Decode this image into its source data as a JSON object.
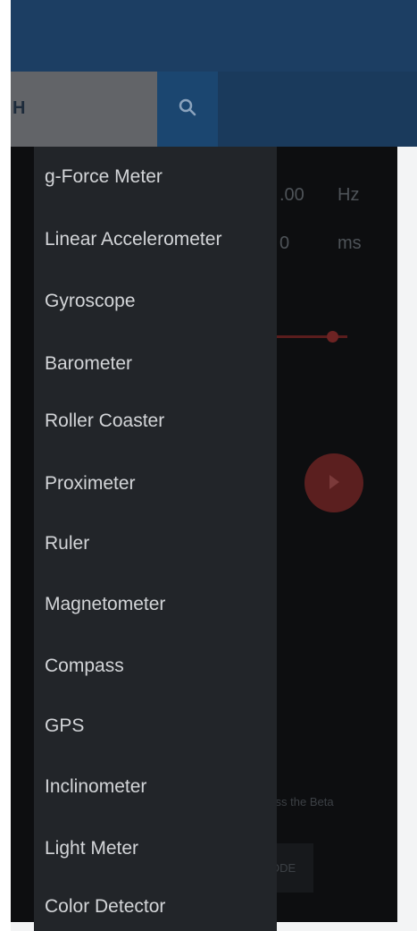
{
  "tab_bar": {
    "active_tab_label": "H"
  },
  "background": {
    "frequency_value": ".00",
    "frequency_unit": "Hz",
    "interval_value": "0",
    "interval_unit": "ms",
    "beta_hint": "ress the Beta",
    "mode_button_label": "ODE"
  },
  "drawer": {
    "items": [
      "g-Force Meter",
      "Linear Accelerometer",
      "Gyroscope",
      "Barometer",
      "Roller Coaster",
      "Proximeter",
      "Ruler",
      "Magnetometer",
      "Compass",
      "GPS",
      "Inclinometer",
      "Light Meter",
      "Color Detector"
    ]
  },
  "colors": {
    "app_bar": "#1c3e63",
    "drawer_background": "#222529",
    "drawer_text": "#d3d5d8",
    "content_background": "#0d0e10",
    "accent_red": "#5b1f1f"
  },
  "icons": {
    "search": "search-icon",
    "play": "play-icon"
  }
}
